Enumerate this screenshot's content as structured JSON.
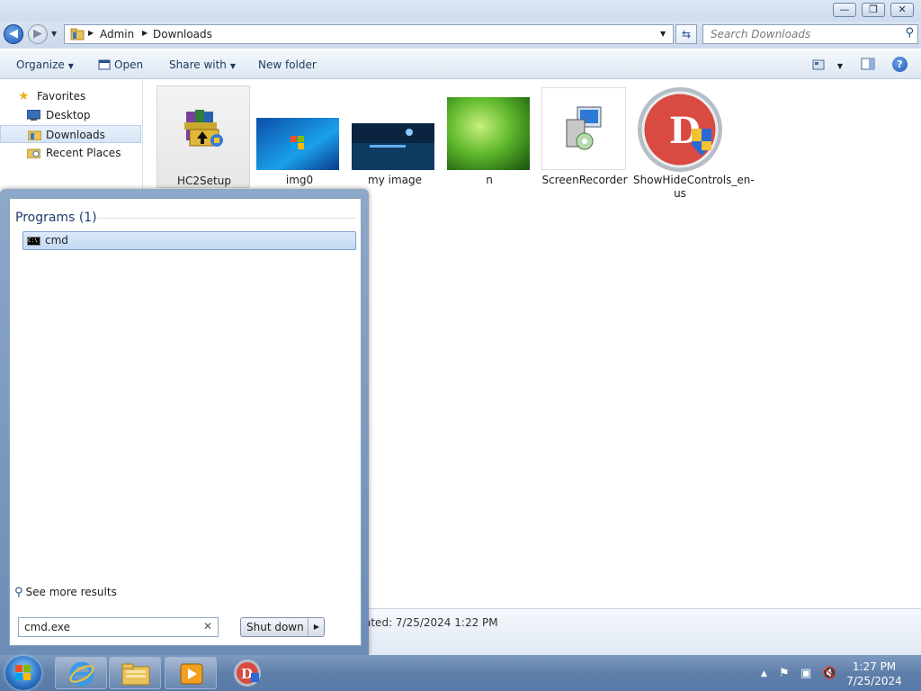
{
  "window": {
    "minimize": "—",
    "restore": "❐",
    "close": "✕"
  },
  "address": {
    "crumbs": [
      "Admin",
      "Downloads"
    ],
    "search_placeholder": "Search Downloads"
  },
  "toolbar": {
    "organize": "Organize",
    "open": "Open",
    "share_with": "Share with",
    "new_folder": "New folder"
  },
  "nav": {
    "favorites": "Favorites",
    "items": [
      "Desktop",
      "Downloads",
      "Recent Places"
    ]
  },
  "files": [
    {
      "name": "HC2Setup"
    },
    {
      "name": "img0"
    },
    {
      "name": "my image"
    },
    {
      "name": "n"
    },
    {
      "name": "ScreenRecorder"
    },
    {
      "name": "ShowHideControls_en-us"
    }
  ],
  "details": {
    "text": "ated: 7/25/2024 1:22 PM"
  },
  "start_menu": {
    "programs_header": "Programs (1)",
    "result": "cmd",
    "see_more": "See more results",
    "search_value": "cmd.exe",
    "shutdown": "Shut down"
  },
  "taskbar": {
    "time": "1:27 PM",
    "date": "7/25/2024"
  },
  "colors": {
    "accent": "#1f5cb8",
    "selection": "#c2d9f3"
  }
}
